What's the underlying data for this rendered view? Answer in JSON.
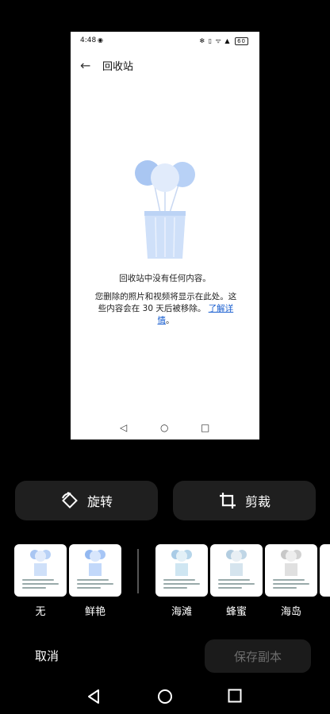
{
  "preview": {
    "status_time": "4:48",
    "status_icons": "✻ ▯ ᯤ ▲",
    "battery": "60",
    "title": "回收站",
    "empty_message": "回收站中没有任何内容。",
    "description": "您删除的照片和视频将显示在此处。这些内容会在 30 天后被移除。",
    "learn_more": "了解详情",
    "learn_more_suffix": "。"
  },
  "actions": {
    "rotate_label": "旋转",
    "crop_label": "剪裁"
  },
  "filters": [
    {
      "label": "无"
    },
    {
      "label": "鲜艳"
    },
    {
      "label": "海滩"
    },
    {
      "label": "蜂蜜"
    },
    {
      "label": "海岛"
    }
  ],
  "bottom": {
    "cancel_label": "取消",
    "save_label": "保存副本"
  }
}
